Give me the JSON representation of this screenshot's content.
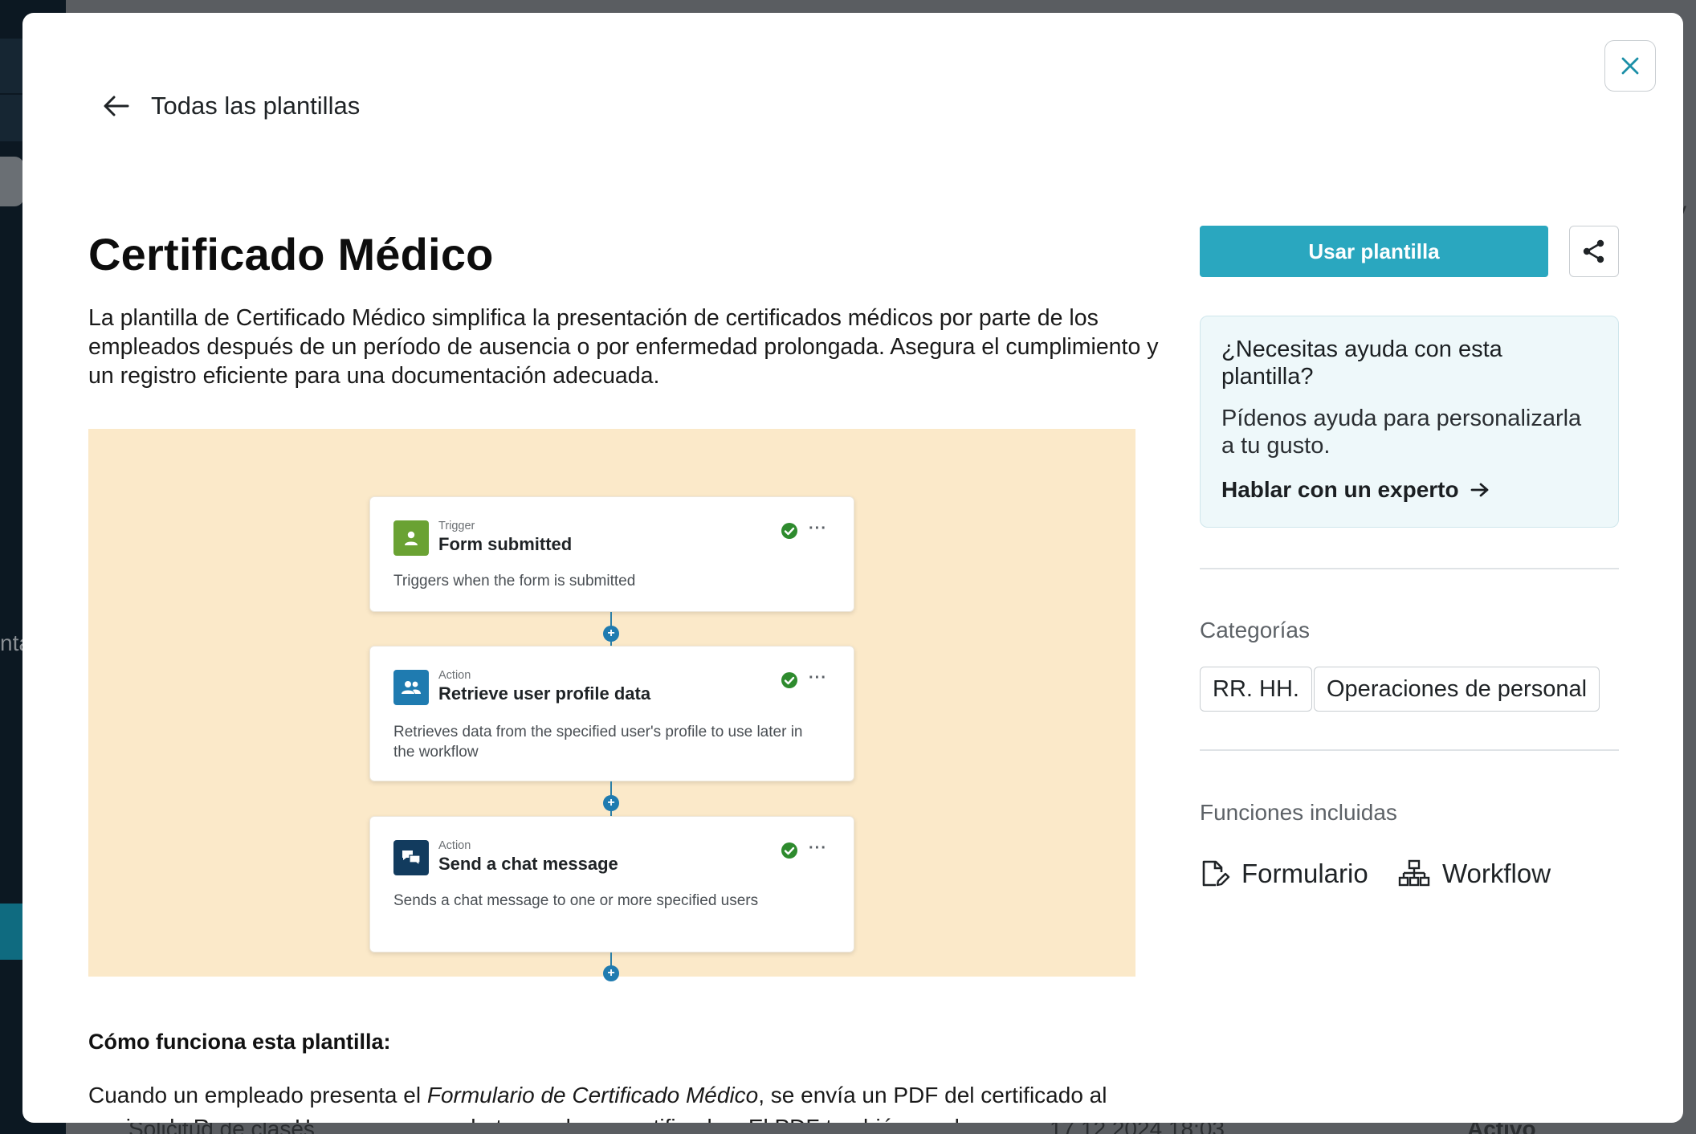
{
  "background": {
    "row_label": "Solicitud de clases",
    "row_date": "17.12.2024 18:03",
    "row_status": "Activo",
    "side_fragment_left": "nta",
    "side_fragment_right": "tiv"
  },
  "nav": {
    "back_label": "Todas las plantillas"
  },
  "template": {
    "title": "Certificado Médico",
    "description": "La plantilla de Certificado Médico simplifica la presentación de certificados médicos por parte de los empleados después de un período de ausencia o por enfermedad prolongada. Asegura el cumplimiento y un registro eficiente para una documentación adecuada."
  },
  "workflow": {
    "steps": [
      {
        "kind": "Trigger",
        "name": "Form submitted",
        "description": "Triggers when the form is submitted",
        "icon": "user-form-icon",
        "color": "#6aa233"
      },
      {
        "kind": "Action",
        "name": "Retrieve user profile data",
        "description": "Retrieves data from the specified user's profile to use later in the workflow",
        "icon": "users-icon",
        "color": "#1f7bb0"
      },
      {
        "kind": "Action",
        "name": "Send a chat message",
        "description": "Sends a chat message to one or more specified users",
        "icon": "chat-icon",
        "color": "#123b5e"
      }
    ],
    "more_glyph": "···",
    "add_glyph": "+"
  },
  "how": {
    "title": "Cómo funciona esta plantilla:",
    "text_before": "Cuando un empleado presenta el ",
    "text_italic": "Formulario de Certificado Médico",
    "text_after": ", se envía un PDF del certificado al equipo de Recursos Humanos en un chat grupal para notificarles. El PDF también se almacena en una carpeta"
  },
  "sidebar": {
    "use_button": "Usar plantilla",
    "help": {
      "title": "¿Necesitas ayuda con esta plantilla?",
      "body": "Pídenos ayuda para personalizarla a tu gusto.",
      "link": "Hablar con un experto"
    },
    "categories_label": "Categorías",
    "categories": [
      "RR. HH.",
      "Operaciones de personal"
    ],
    "features_label": "Funciones incluidas",
    "features": [
      {
        "label": "Formulario",
        "icon": "form-edit-icon"
      },
      {
        "label": "Workflow",
        "icon": "workflow-icon"
      }
    ]
  },
  "colors": {
    "accent": "#2aa7bf",
    "preview_bg": "#fbe9c9",
    "help_bg": "#eef8fa",
    "check_green": "#2e8b2e"
  }
}
